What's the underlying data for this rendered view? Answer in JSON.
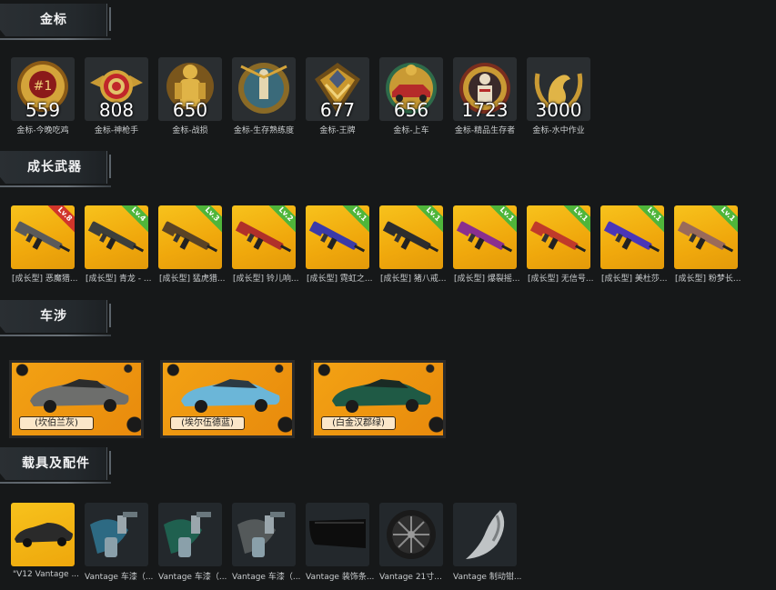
{
  "sections": {
    "medals": {
      "title": "金标"
    },
    "weapons": {
      "title": "成长武器"
    },
    "cars": {
      "title": "车涉"
    },
    "vehicles": {
      "title": "载具及配件"
    }
  },
  "medals": [
    {
      "count": "559",
      "caption": "金标-今晚吃鸡",
      "icon": "chicken-dinner-medal-icon"
    },
    {
      "count": "808",
      "caption": "金标-神枪手",
      "icon": "target-medal-icon"
    },
    {
      "count": "650",
      "caption": "金标-战损",
      "icon": "soldier-medal-icon"
    },
    {
      "count": "",
      "caption": "金标-生存熟练度",
      "icon": "survival-medal-icon"
    },
    {
      "count": "677",
      "caption": "金标-王牌",
      "icon": "ace-medal-icon"
    },
    {
      "count": "656",
      "caption": "金标-上车",
      "icon": "car-medal-icon"
    },
    {
      "count": "1723",
      "caption": "金标-精品生存者",
      "icon": "survivor-medal-icon"
    },
    {
      "count": "3000",
      "caption": "金标-水中作业",
      "icon": "seal-medal-icon"
    }
  ],
  "weapons": [
    {
      "caption": "[成长型] 恶魔猎...",
      "level": "Lv.8",
      "badge": "red",
      "color": "#5a5a5a"
    },
    {
      "caption": "[成长型] 青龙 - ...",
      "level": "Lv.4",
      "badge": "green",
      "color": "#3d3f3b"
    },
    {
      "caption": "[成长型] 猛虎猎...",
      "level": "Lv.3",
      "badge": "green",
      "color": "#5a4325"
    },
    {
      "caption": "[成长型] 铃儿响...",
      "level": "Lv.2",
      "badge": "green",
      "color": "#b0302a"
    },
    {
      "caption": "[成长型] 霓虹之...",
      "level": "Lv.1",
      "badge": "green",
      "color": "#3b3aa8"
    },
    {
      "caption": "[成长型] 猪八戒...",
      "level": "Lv.1",
      "badge": "green",
      "color": "#2d2d2d"
    },
    {
      "caption": "[成长型] 爆裂摇...",
      "level": "Lv.1",
      "badge": "green",
      "color": "#8a2f8f"
    },
    {
      "caption": "[成长型] 无信号...",
      "level": "Lv.1",
      "badge": "green",
      "color": "#c03a2a"
    },
    {
      "caption": "[成长型] 美杜莎...",
      "level": "Lv.1",
      "badge": "green",
      "color": "#4a36b8"
    },
    {
      "caption": "[成长型] 粉梦长...",
      "level": "Lv.1",
      "badge": "green",
      "color": "#9a6a5a"
    }
  ],
  "cars": [
    {
      "label": "(坎伯兰灰)",
      "color": "#6d6e6c"
    },
    {
      "label": "(埃尔伍德蓝)",
      "color": "#6bb6d8"
    },
    {
      "label": "(白金汉郡绿)",
      "color": "#1f5a45"
    }
  ],
  "vehicles": [
    {
      "caption": "\"V12 Vantage ...",
      "icon": "car-icon"
    },
    {
      "caption": "Vantage 车漆（...",
      "icon": "blue-paint-icon"
    },
    {
      "caption": "Vantage 车漆（...",
      "icon": "green-paint-icon"
    },
    {
      "caption": "Vantage 车漆（...",
      "icon": "gray-paint-icon"
    },
    {
      "caption": "Vantage 装饰条...",
      "icon": "trim-icon"
    },
    {
      "caption": "Vantage 21寸...",
      "icon": "wheel-icon"
    },
    {
      "caption": "Vantage 制动钳...",
      "icon": "brake-caliper-icon"
    }
  ]
}
